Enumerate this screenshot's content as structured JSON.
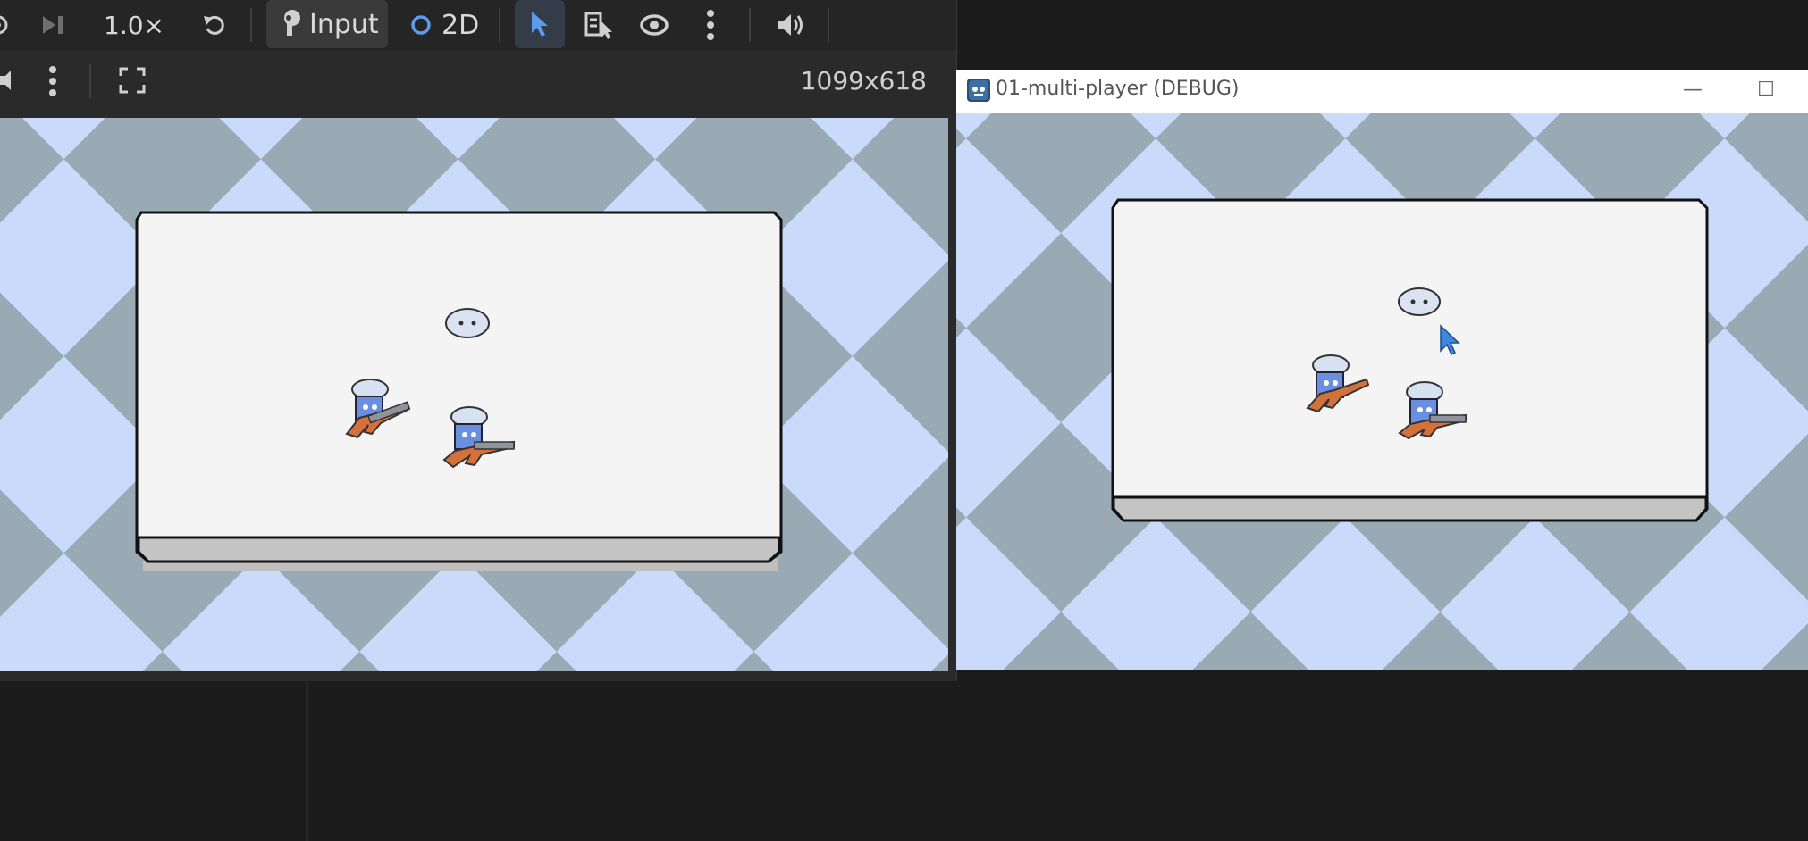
{
  "toolbar": {
    "speed_label": "1.0×",
    "input_label": "Input",
    "mode_label": "2D"
  },
  "viewport": {
    "size_label": "1099x618"
  },
  "debug_window": {
    "title": "01-multi-player (DEBUG)",
    "minimize_symbol": "—",
    "maximize_symbol": "☐"
  },
  "colors": {
    "checker_light": "#c9dafa",
    "checker_dark": "#9aaab5",
    "arena_fill": "#f4f4f4",
    "accent_blue": "#3f87e0"
  }
}
